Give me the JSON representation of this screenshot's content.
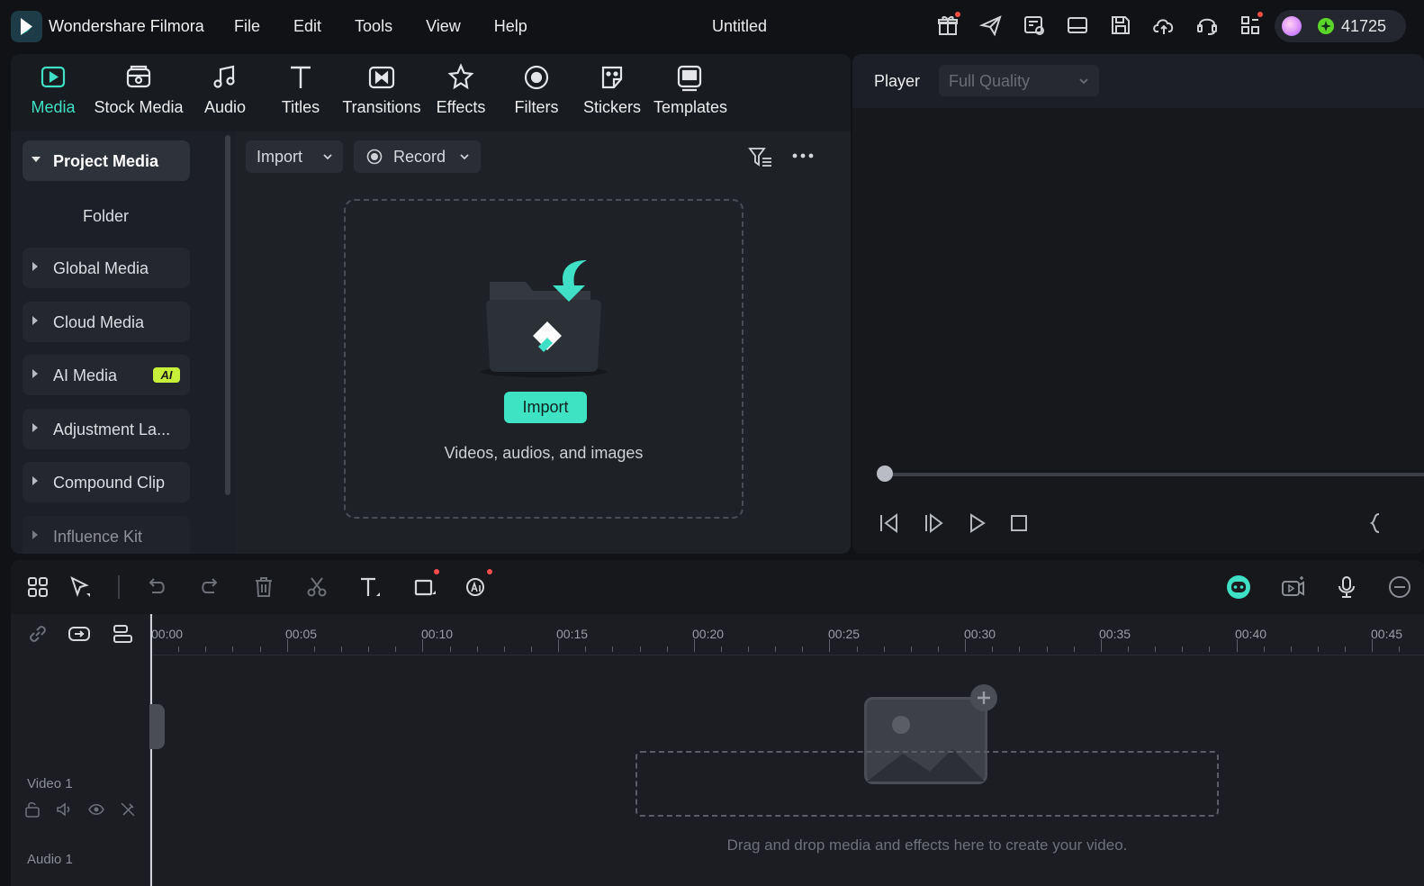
{
  "app": {
    "name": "Wondershare Filmora",
    "document_title": "Untitled",
    "credits": "41725"
  },
  "menu": [
    "File",
    "Edit",
    "Tools",
    "View",
    "Help"
  ],
  "top_icons": [
    "gift-icon",
    "send-icon",
    "feedback-icon",
    "layout-icon",
    "save-icon",
    "cloud-upload-icon",
    "support-icon",
    "apps-icon"
  ],
  "tabs": [
    {
      "label": "Media",
      "icon": "media-icon",
      "active": true
    },
    {
      "label": "Stock Media",
      "icon": "stock-media-icon"
    },
    {
      "label": "Audio",
      "icon": "music-note-icon"
    },
    {
      "label": "Titles",
      "icon": "text-t-icon"
    },
    {
      "label": "Transitions",
      "icon": "transitions-icon"
    },
    {
      "label": "Effects",
      "icon": "effects-star-icon"
    },
    {
      "label": "Filters",
      "icon": "filters-icon"
    },
    {
      "label": "Stickers",
      "icon": "sticker-icon"
    },
    {
      "label": "Templates",
      "icon": "templates-icon"
    }
  ],
  "sidebar": {
    "items": [
      {
        "label": "Project Media",
        "expanded": true
      },
      {
        "label": "Folder"
      },
      {
        "label": "Global Media"
      },
      {
        "label": "Cloud Media"
      },
      {
        "label": "AI Media",
        "badge": "AI"
      },
      {
        "label": "Adjustment La..."
      },
      {
        "label": "Compound Clip"
      },
      {
        "label": "Influence Kit"
      }
    ]
  },
  "media": {
    "import_label": "Import",
    "record_label": "Record",
    "drop_button": "Import",
    "drop_subtitle": "Videos, audios, and images"
  },
  "player": {
    "label": "Player",
    "quality": "Full Quality"
  },
  "timeline": {
    "ticks": [
      "00:00",
      "00:05",
      "00:10",
      "00:15",
      "00:20",
      "00:25",
      "00:30",
      "00:35",
      "00:40",
      "00:45"
    ],
    "tracks": [
      "Video 1",
      "Audio 1"
    ],
    "drop_hint": "Drag and drop media and effects here to create your video."
  },
  "colors": {
    "accent": "#3fe0c5",
    "background": "#101216",
    "panel": "#1c1f25"
  }
}
